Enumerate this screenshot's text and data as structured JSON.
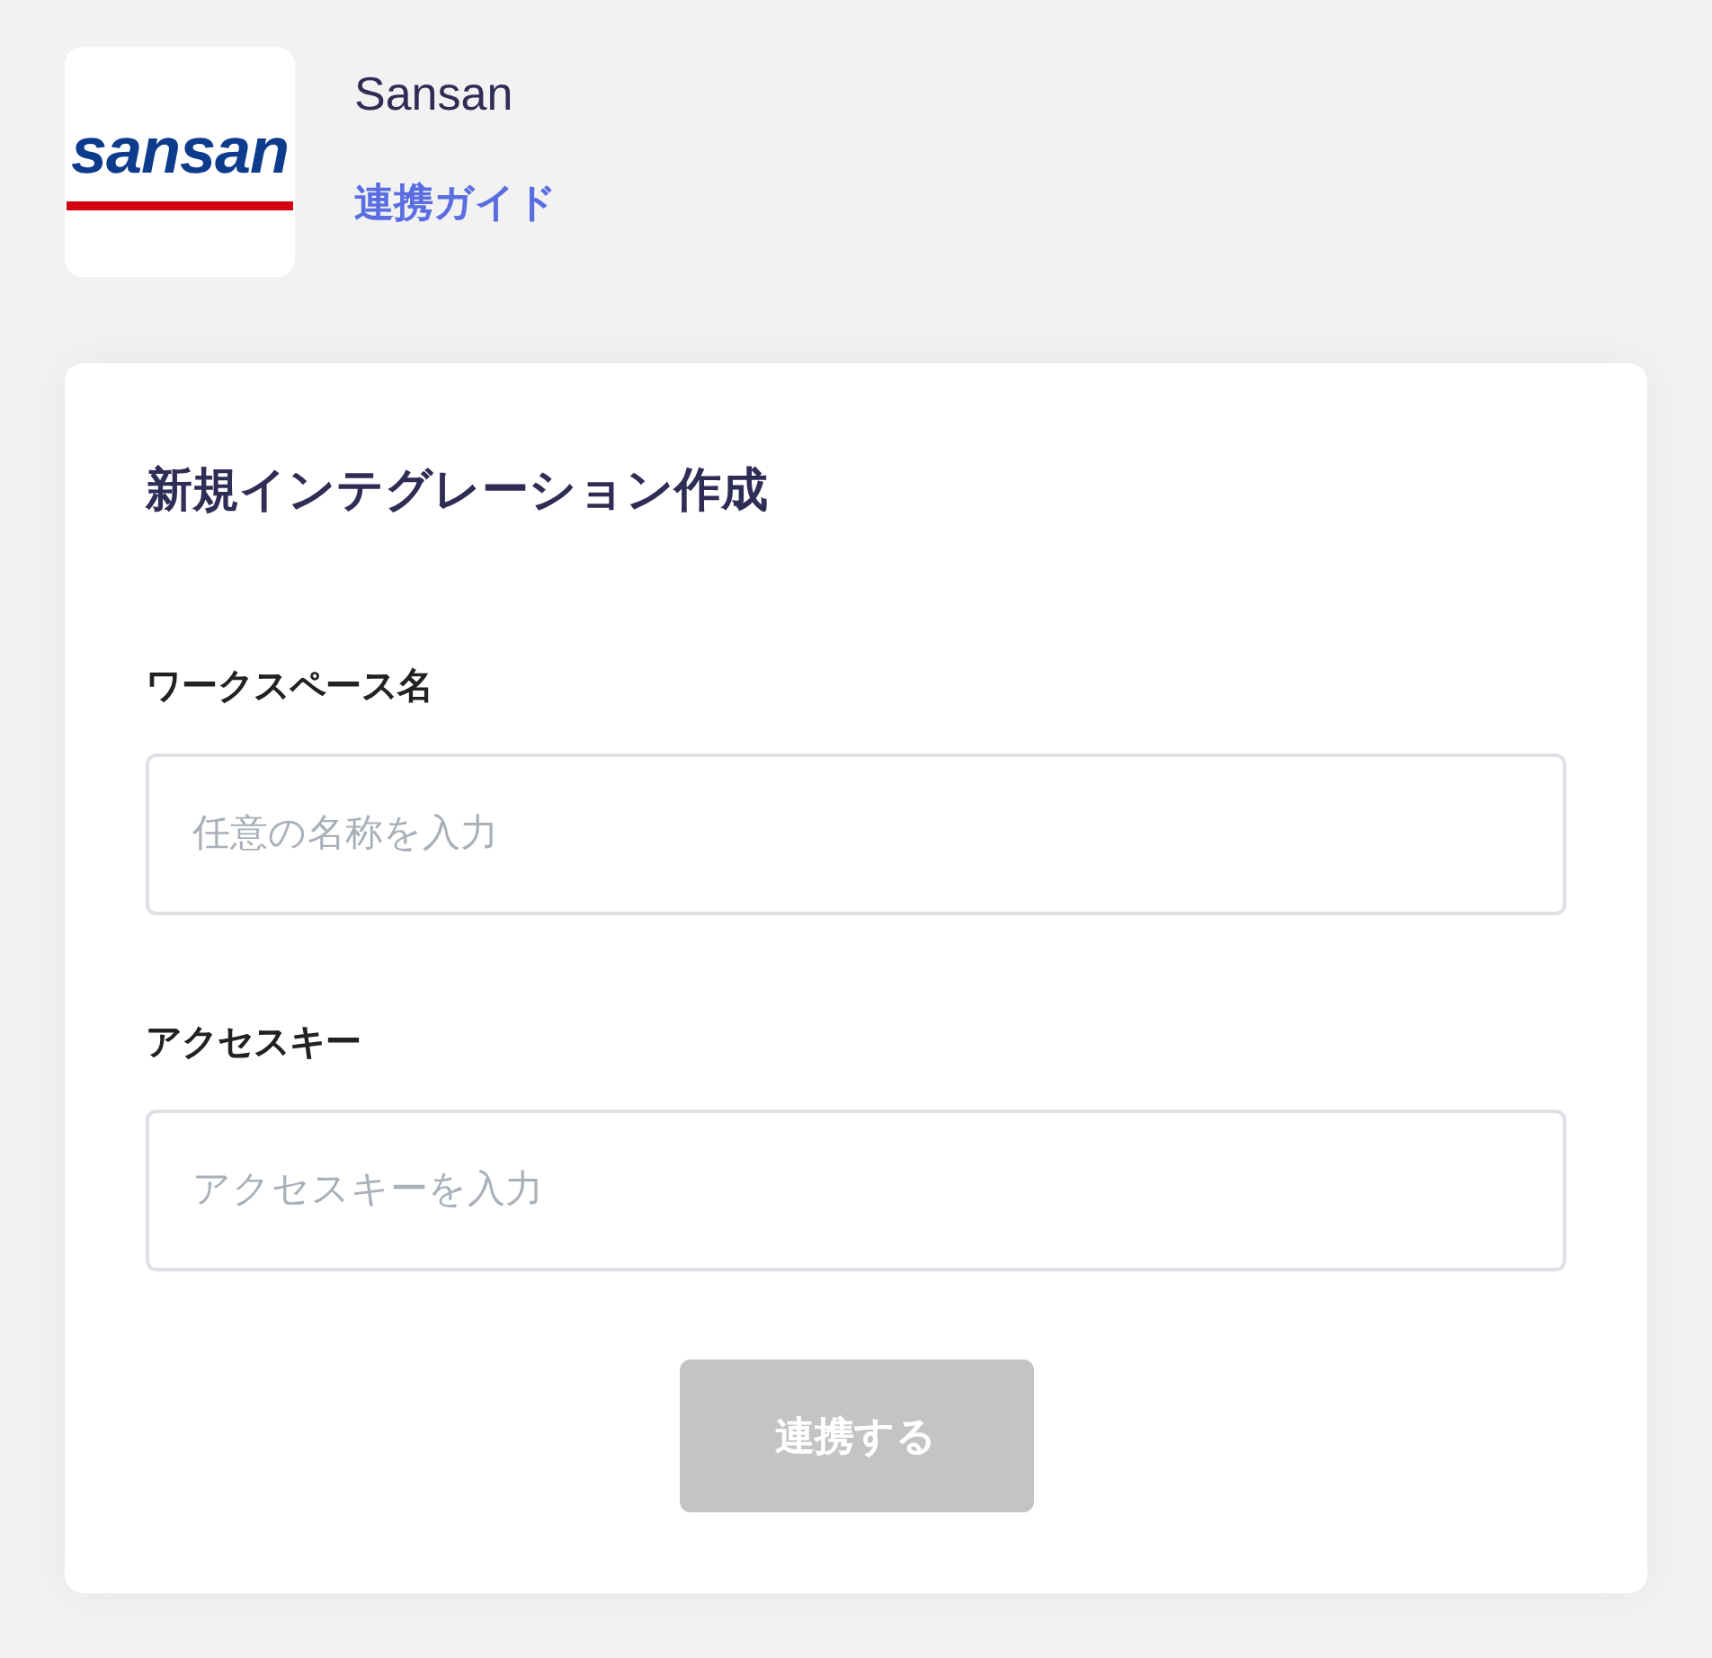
{
  "app": {
    "logo_text": "sansan",
    "name": "Sansan",
    "guide_link": "連携ガイド"
  },
  "form": {
    "title": "新規インテグレーション作成",
    "fields": [
      {
        "label": "ワークスペース名",
        "placeholder": "任意の名称を入力"
      },
      {
        "label": "アクセスキー",
        "placeholder": "アクセスキーを入力"
      }
    ],
    "submit": {
      "label": "連携する",
      "disabled": true
    }
  }
}
